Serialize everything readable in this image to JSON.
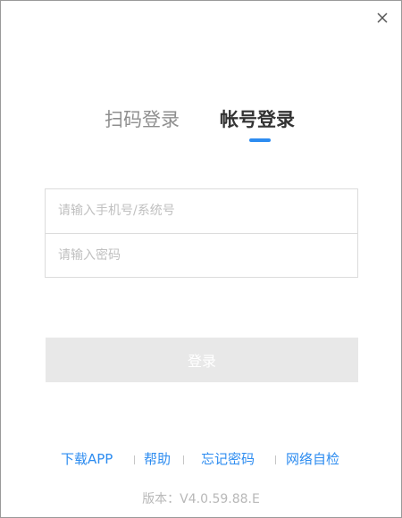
{
  "window": {
    "close_icon": "close-icon"
  },
  "tabs": {
    "qr_login": "扫码登录",
    "account_login": "帐号登录",
    "active": "account_login",
    "active_color": "#2d8cf0"
  },
  "form": {
    "account_placeholder": "请输入手机号/系统号",
    "account_value": "",
    "password_placeholder": "请输入密码",
    "password_value": ""
  },
  "login_button": {
    "label": "登录",
    "enabled": false,
    "background": "#e8e8e8"
  },
  "links": {
    "download_app": "下载APP",
    "help": "帮助",
    "forgot_password": "忘记密码",
    "network_check": "网络自检",
    "color": "#2d8cf0"
  },
  "version": "版本：V4.0.59.88.E"
}
